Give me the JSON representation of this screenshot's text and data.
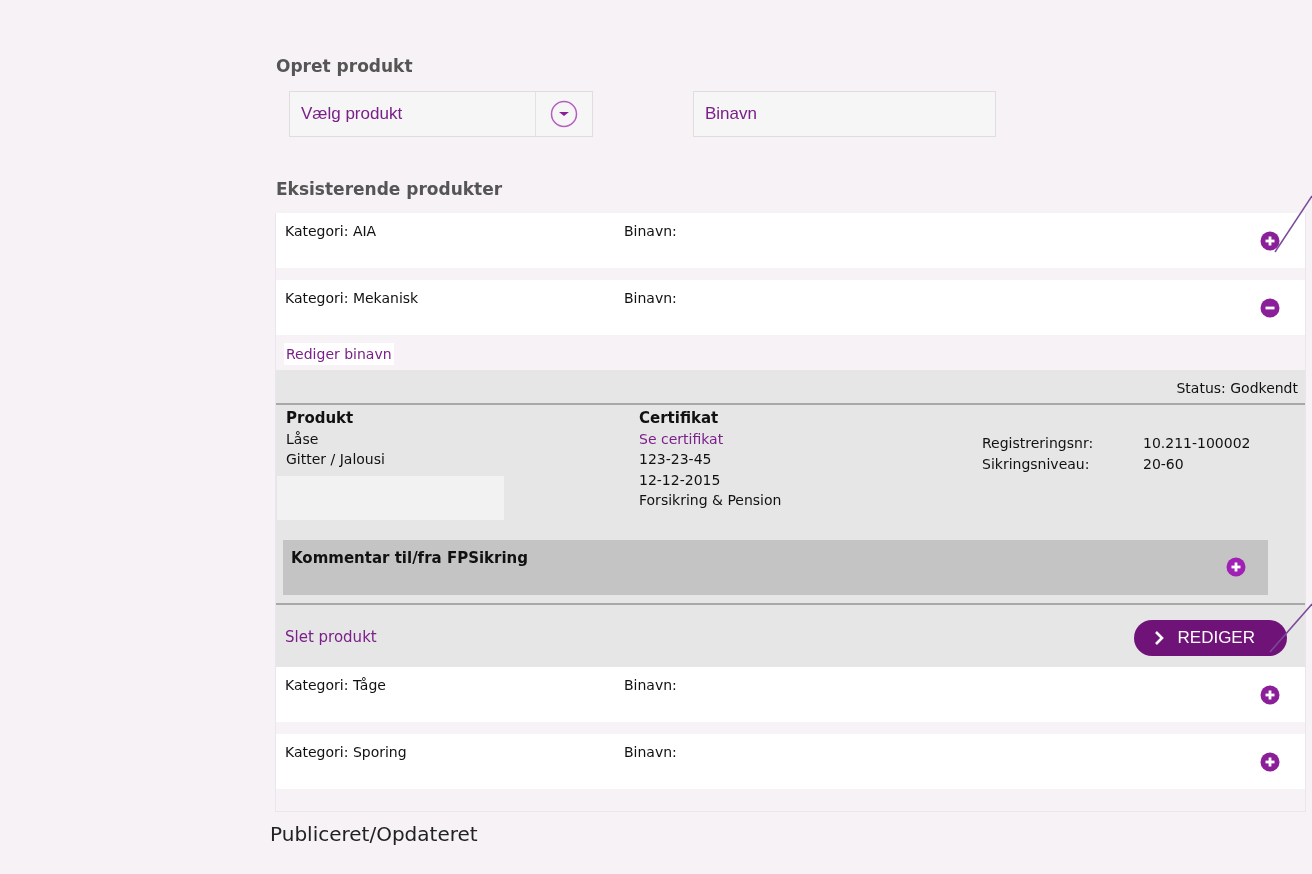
{
  "create": {
    "title": "Opret produkt",
    "product_select": {
      "placeholder": "Vælg produkt"
    },
    "binavn_field": {
      "placeholder": "Binavn"
    }
  },
  "existing": {
    "title": "Eksisterende produkter",
    "products": [
      {
        "category": "Kategori: AIA",
        "binavn": "Binavn:",
        "expanded": false
      },
      {
        "category": "Kategori: Mekanisk",
        "binavn": "Binavn:",
        "expanded": true,
        "details": {
          "edit_link": "Rediger binavn",
          "status": "Status: Godkendt",
          "product_heading": "Produkt",
          "product_lines": [
            "Låse",
            "Gitter / Jalousi"
          ],
          "certificate_heading": "Certifikat",
          "certificate_link": "Se certifikat",
          "certificate_lines": [
            "123-23-45",
            "12-12-2015",
            "Forsikring & Pension"
          ],
          "fields": [
            {
              "label": "Registreringsnr:",
              "value": "10.211-100002"
            },
            {
              "label": "Sikringsniveau:",
              "value": "20-60"
            }
          ],
          "comment": {
            "title": "Kommentar til/fra FPSikring",
            "expanded": false
          },
          "delete_link": "Slet produkt",
          "edit_button": "REDIGER"
        }
      },
      {
        "category": "Kategori: Tåge",
        "binavn": "Binavn:",
        "expanded": false
      },
      {
        "category": "Kategori: Sporing",
        "binavn": "Binavn:",
        "expanded": false
      }
    ]
  },
  "footer": "Publiceret/Opdateret"
}
